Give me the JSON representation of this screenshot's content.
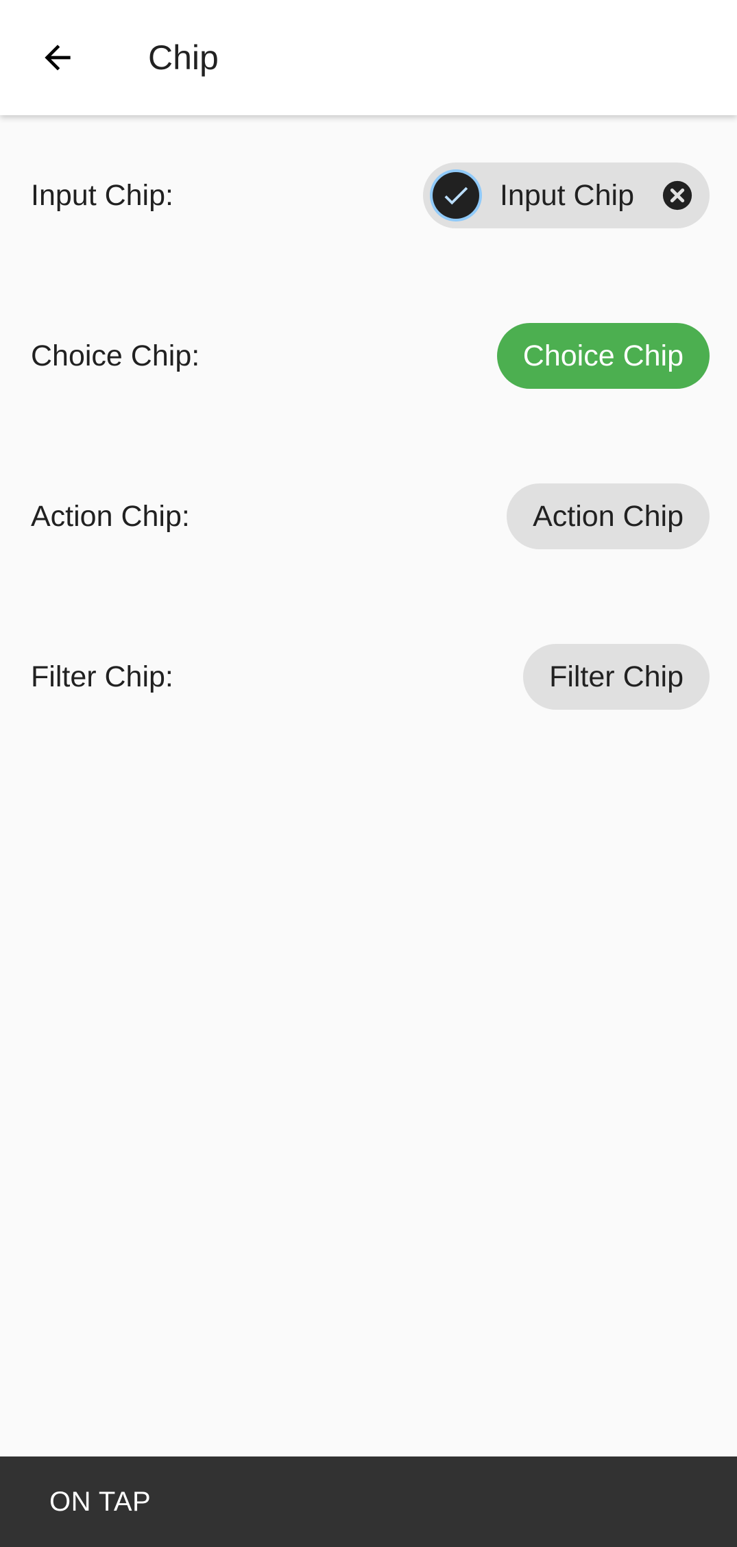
{
  "app_bar": {
    "title": "Chip",
    "back_icon": "arrow-back-icon"
  },
  "rows": [
    {
      "label": "Input Chip:",
      "chip_label": "Input Chip",
      "chip_type": "input",
      "avatar_icon": "check-circle-icon",
      "delete_icon": "cancel-icon"
    },
    {
      "label": "Choice Chip:",
      "chip_label": "Choice Chip",
      "chip_type": "choice",
      "selected": true
    },
    {
      "label": "Action Chip:",
      "chip_label": "Action Chip",
      "chip_type": "action"
    },
    {
      "label": "Filter Chip:",
      "chip_label": "Filter Chip",
      "chip_type": "filter"
    }
  ],
  "snackbar": {
    "text": "ON TAP"
  },
  "colors": {
    "background": "#fafafa",
    "app_bar": "#ffffff",
    "chip_default": "#e0e0e0",
    "chip_selected": "#4caf50",
    "snackbar": "#323232",
    "avatar_ring": "#90caf9"
  }
}
